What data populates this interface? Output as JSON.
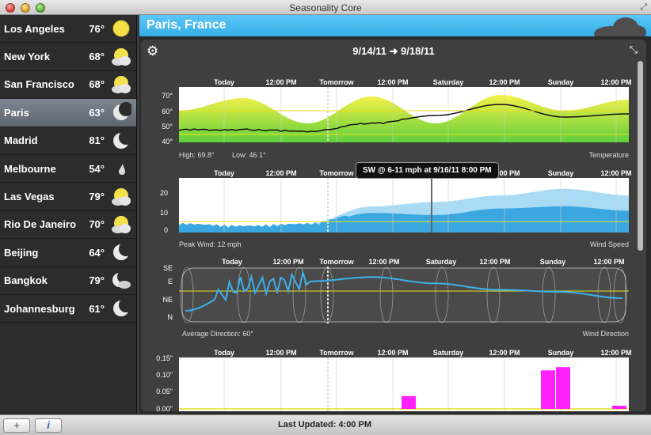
{
  "window": {
    "title": "Seasonality Core"
  },
  "sidebar": {
    "cities": [
      {
        "name": "Los Angeles",
        "temp": "76°",
        "icon": "sun-icon"
      },
      {
        "name": "New York",
        "temp": "68°",
        "icon": "partly-cloudy-icon"
      },
      {
        "name": "San Francisco",
        "temp": "68°",
        "icon": "partly-cloudy-icon"
      },
      {
        "name": "Paris",
        "temp": "63°",
        "icon": "moon-icon",
        "selected": true
      },
      {
        "name": "Madrid",
        "temp": "81°",
        "icon": "moon-icon"
      },
      {
        "name": "Melbourne",
        "temp": "54°",
        "icon": "raindrop-icon"
      },
      {
        "name": "Las Vegas",
        "temp": "79°",
        "icon": "partly-cloudy-icon"
      },
      {
        "name": "Rio De Janeiro",
        "temp": "70°",
        "icon": "partly-cloudy-icon"
      },
      {
        "name": "Beijing",
        "temp": "64°",
        "icon": "moon-icon"
      },
      {
        "name": "Bangkok",
        "temp": "79°",
        "icon": "moon-cloud-icon"
      },
      {
        "name": "Johannesburg",
        "temp": "61°",
        "icon": "moon-icon"
      }
    ]
  },
  "header": {
    "location": "Paris, France"
  },
  "toolbar": {
    "date_range": "9/14/11 ➜ 9/18/11",
    "add_label": "+",
    "info_label": "i"
  },
  "footer": {
    "last_updated": "Last Updated: 4:00 PM"
  },
  "time_labels": [
    "Today",
    "12:00 PM",
    "Tomorrow",
    "12:00 PM",
    "Saturday",
    "12:00 PM",
    "Sunday",
    "12:00 PM"
  ],
  "tooltip": "SW @ 6-11 mph at 9/16/11 8:00 PM",
  "charts": {
    "temperature": {
      "title": "Temperature",
      "y_ticks": [
        "70°",
        "60°",
        "50°",
        "40°"
      ],
      "high": "High: 69.8°",
      "low": "Low: 46.1°"
    },
    "wind": {
      "title": "Wind Speed",
      "y_ticks": [
        "20",
        "10",
        "0"
      ],
      "peak": "Peak Wind: 12 mph"
    },
    "direction": {
      "title": "Wind Direction",
      "y_ticks": [
        "SE",
        "E",
        "NE",
        "N"
      ],
      "average": "Average Direction: 60°"
    },
    "precipitation": {
      "y_ticks": [
        "0.15\"",
        "0.10\"",
        "0.05\"",
        "0.00\""
      ]
    }
  },
  "colors": {
    "accent": "#3cb4ec",
    "temp_fill": "#c8e84a",
    "wind_fill": "#3aa7e0",
    "precip": "#ff22ff",
    "threshold": "#e6e020"
  },
  "chart_data": [
    {
      "type": "area",
      "title": "Temperature",
      "x": [
        "Today",
        "12:00 PM",
        "Tomorrow",
        "12:00 PM",
        "Saturday",
        "12:00 PM",
        "Sunday",
        "12:00 PM"
      ],
      "series": [
        {
          "values": [
            60,
            68,
            52,
            69,
            52,
            70,
            60,
            67
          ]
        },
        {
          "values": [
            48,
            48,
            47,
            52,
            57,
            64,
            56,
            58
          ]
        }
      ],
      "ylim": [
        40,
        75
      ]
    },
    {
      "type": "area",
      "title": "Wind Speed",
      "x": [
        "Today",
        "12:00 PM",
        "Tomorrow",
        "12:00 PM",
        "Saturday",
        "12:00 PM",
        "Sunday",
        "12:00 PM"
      ],
      "series": [
        {
          "values": [
            3,
            2,
            3,
            9,
            8,
            11,
            12,
            10
          ]
        },
        {
          "values": [
            4,
            2,
            4,
            12,
            14,
            17,
            20,
            17
          ]
        }
      ],
      "ylim": [
        0,
        25
      ]
    },
    {
      "type": "line",
      "title": "Wind Direction",
      "x": [
        "Today",
        "12:00 PM",
        "Tomorrow",
        "12:00 PM",
        "Saturday",
        "12:00 PM",
        "Sunday",
        "12:00 PM"
      ],
      "series": [
        {
          "values": [
            30,
            90,
            100,
            110,
            95,
            80,
            75,
            60
          ]
        }
      ]
    },
    {
      "type": "bar",
      "categories": [
        "Saturday",
        "Sunday",
        "Sunday",
        "Sunday"
      ],
      "values": [
        0.04,
        0.12,
        0.13,
        0.01
      ],
      "ylim": [
        0,
        0.16
      ]
    }
  ]
}
